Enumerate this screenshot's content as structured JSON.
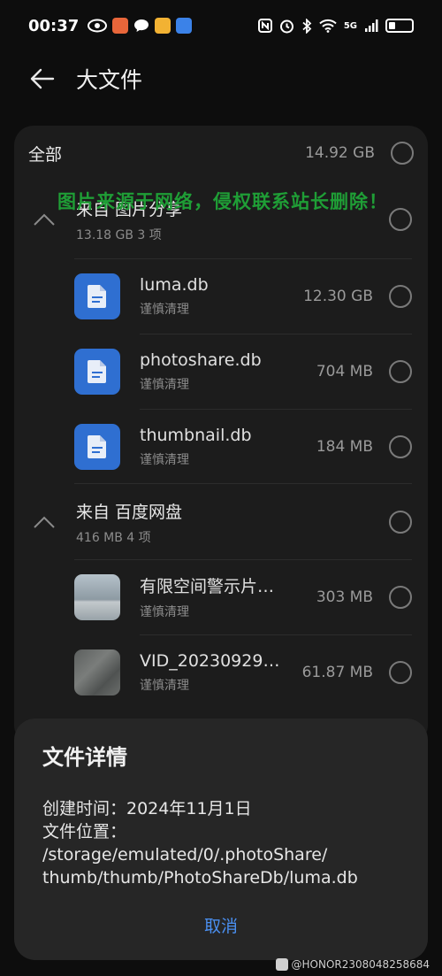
{
  "status_bar": {
    "time": "00:37",
    "network": "5G",
    "battery_level": 0.3
  },
  "header": {
    "back_icon": "arrow-left-icon",
    "title": "大文件"
  },
  "list": {
    "all_row": {
      "label": "全部",
      "size": "14.92 GB"
    },
    "groups": [
      {
        "title": "来自 图片分享",
        "subtitle": "13.18 GB 3 项",
        "items": [
          {
            "name": "luma.db",
            "note": "谨慎清理",
            "size": "12.30 GB",
            "icon": "document-icon"
          },
          {
            "name": "photoshare.db",
            "note": "谨慎清理",
            "size": "704 MB",
            "icon": "document-icon"
          },
          {
            "name": "thumbnail.db",
            "note": "谨慎清理",
            "size": "184 MB",
            "icon": "document-icon"
          }
        ]
      },
      {
        "title": "来自 百度网盘",
        "subtitle": "416 MB 4 项",
        "items": [
          {
            "name": "有限空间警示片…",
            "note": "谨慎清理",
            "size": "303 MB",
            "icon": "image-thumbnail"
          },
          {
            "name": "VID_20230929…",
            "note": "谨慎清理",
            "size": "61.87 MB",
            "icon": "video-thumbnail"
          }
        ]
      }
    ]
  },
  "watermark_text": "图片来源于网络，侵权联系站长删除！",
  "sheet": {
    "title": "文件详情",
    "created_line": "创建时间：2024年11月1日",
    "location_label": "文件位置：",
    "location_line1": "/storage/emulated/0/.photoShare/",
    "location_line2": "thumb/thumb/PhotoShareDb/luma.db",
    "cancel_label": "取消"
  },
  "corner_watermark": "@HONOR2308048258684",
  "colors": {
    "accent": "#4a8ff0",
    "doc_icon_bg": "#2f6fd1",
    "watermark": "#1f9e36"
  }
}
